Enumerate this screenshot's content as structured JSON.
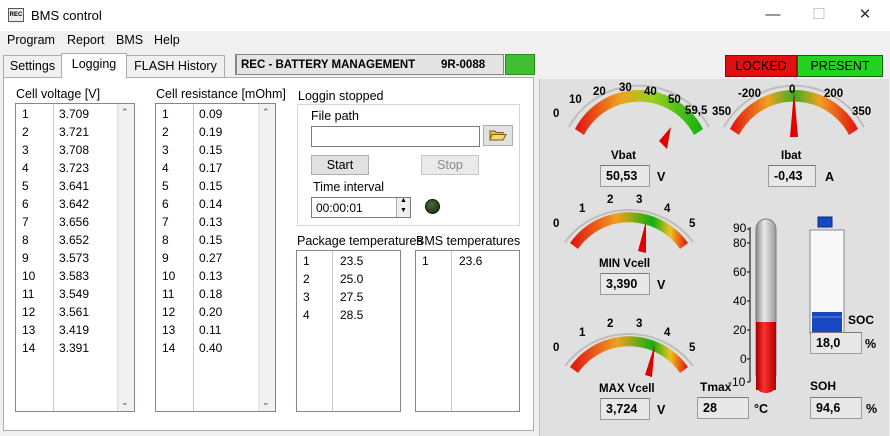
{
  "window": {
    "title": "BMS control",
    "icon_text": "REC",
    "min": "—",
    "max": "☐",
    "close": "✕"
  },
  "menu": [
    "Program",
    "Report",
    "BMS",
    "Help"
  ],
  "tabs": [
    "Settings",
    "Logging",
    "FLASH History"
  ],
  "header": {
    "name": "REC - BATTERY MANAGEMENT",
    "code": "9R-0088"
  },
  "status": {
    "locked": "LOCKED",
    "present": "PRESENT",
    "colors": {
      "locked": "#e01010",
      "present": "#22d322",
      "ok_indicator": "#40c030"
    }
  },
  "cell_voltage": {
    "title": "Cell voltage [V]",
    "rows": [
      [
        "1",
        "3.709"
      ],
      [
        "2",
        "3.721"
      ],
      [
        "3",
        "3.708"
      ],
      [
        "4",
        "3.723"
      ],
      [
        "5",
        "3.641"
      ],
      [
        "6",
        "3.642"
      ],
      [
        "7",
        "3.656"
      ],
      [
        "8",
        "3.652"
      ],
      [
        "9",
        "3.573"
      ],
      [
        "10",
        "3.583"
      ],
      [
        "11",
        "3.549"
      ],
      [
        "12",
        "3.561"
      ],
      [
        "13",
        "3.419"
      ],
      [
        "14",
        "3.391"
      ]
    ]
  },
  "cell_resistance": {
    "title": "Cell resistance [mOhm]",
    "rows": [
      [
        "1",
        "0.09"
      ],
      [
        "2",
        "0.19"
      ],
      [
        "3",
        "0.15"
      ],
      [
        "4",
        "0.17"
      ],
      [
        "5",
        "0.15"
      ],
      [
        "6",
        "0.14"
      ],
      [
        "7",
        "0.13"
      ],
      [
        "8",
        "0.15"
      ],
      [
        "9",
        "0.27"
      ],
      [
        "10",
        "0.13"
      ],
      [
        "11",
        "0.18"
      ],
      [
        "12",
        "0.20"
      ],
      [
        "13",
        "0.11"
      ],
      [
        "14",
        "0.40"
      ]
    ]
  },
  "logging": {
    "status": "Loggin stopped",
    "file_path_label": "File path",
    "file_path_value": "",
    "start_label": "Start",
    "stop_label": "Stop",
    "interval_label": "Time interval",
    "interval_value": "00:00:01"
  },
  "package_temps": {
    "title": "Package temperatures",
    "rows": [
      [
        "1",
        "23.5"
      ],
      [
        "2",
        "25.0"
      ],
      [
        "3",
        "27.5"
      ],
      [
        "4",
        "28.5"
      ]
    ]
  },
  "bms_temps": {
    "title": "BMS temperatures",
    "rows": [
      [
        "1",
        "23.6"
      ]
    ]
  },
  "gauges": {
    "vbat": {
      "label": "Vbat",
      "value": "50,53",
      "unit": "V",
      "ticks": [
        "0",
        "10",
        "20",
        "30",
        "40",
        "50",
        "59,5"
      ]
    },
    "ibat": {
      "label": "Ibat",
      "value": "-0,43",
      "unit": "A",
      "ticks": [
        "350",
        "-200",
        "0",
        "200",
        "350"
      ]
    },
    "min_vcell": {
      "label": "MIN Vcell",
      "value": "3,390",
      "unit": "V",
      "ticks": [
        "0",
        "1",
        "2",
        "3",
        "4",
        "5"
      ]
    },
    "max_vcell": {
      "label": "MAX Vcell",
      "value": "3,724",
      "unit": "V",
      "ticks": [
        "0",
        "1",
        "2",
        "3",
        "4",
        "5"
      ]
    }
  },
  "tmax": {
    "label": "Tmax",
    "value": "28",
    "unit": "°C",
    "ticks": [
      "90",
      "80",
      "60",
      "40",
      "20",
      "0",
      "-10"
    ]
  },
  "soc": {
    "label": "SOC",
    "value": "18,0",
    "unit": "%"
  },
  "soh": {
    "label": "SOH",
    "value": "94,6",
    "unit": "%"
  }
}
